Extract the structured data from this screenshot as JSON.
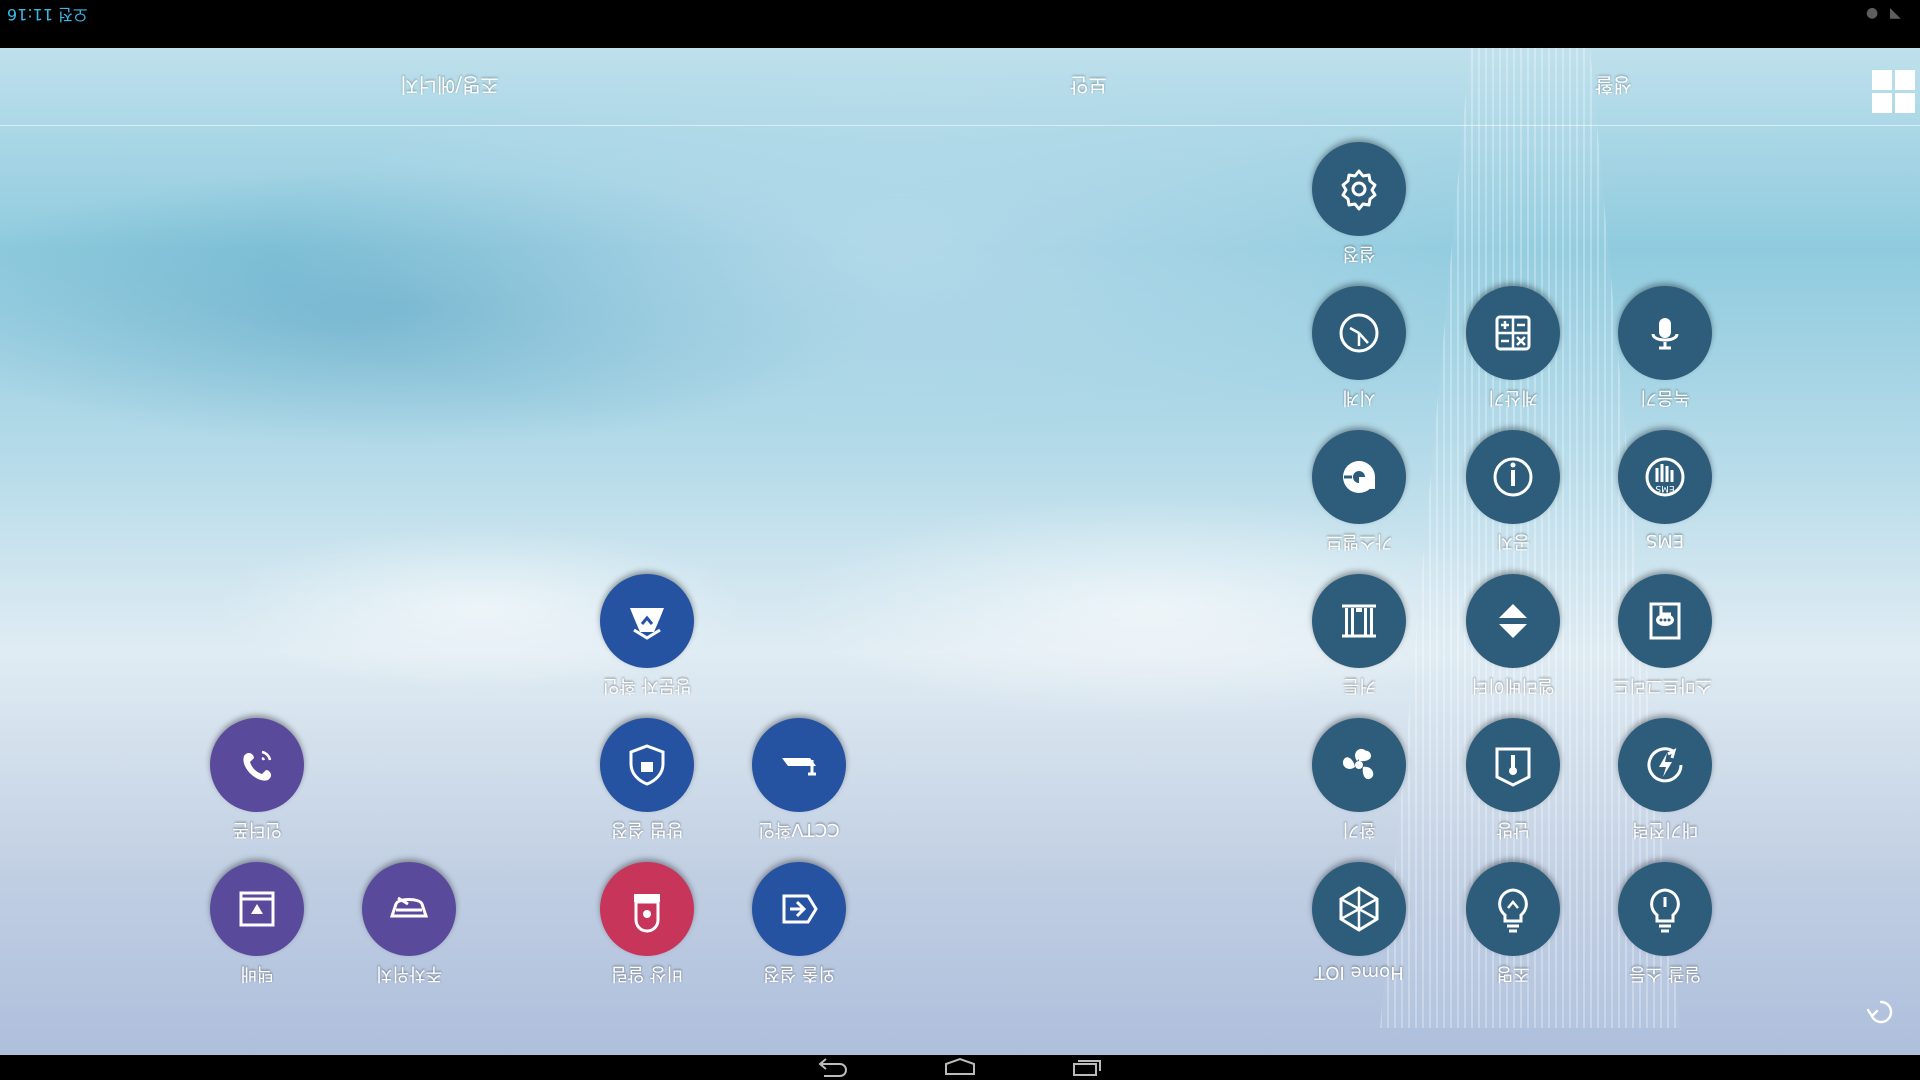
{
  "status_bar": {
    "time": "오전 11:16"
  },
  "dock": {
    "tabs": [
      "조명/에너지",
      "보안",
      "생활"
    ],
    "apps_icon": "app-grid-icon"
  },
  "apps": [
    {
      "id": "light-all-off",
      "label": "일괄 소등",
      "icon": "power-bulb-icon",
      "color": "#2d5d7b"
    },
    {
      "id": "light",
      "label": "조명",
      "icon": "bulb-icon",
      "color": "#2d5d7b"
    },
    {
      "id": "home-iot",
      "label": "Home IOT",
      "icon": "hex-network-icon",
      "color": "#2d5d7b"
    },
    {
      "id": "standby-power",
      "label": "대기전력",
      "icon": "lightning-cycle-icon",
      "color": "#2d5d7b"
    },
    {
      "id": "heating",
      "label": "난방",
      "icon": "thermometer-icon",
      "color": "#2d5d7b"
    },
    {
      "id": "fan",
      "label": "환기",
      "icon": "fan-icon",
      "color": "#2d5d7b"
    },
    {
      "id": "smart-grid",
      "label": "스마트그리드",
      "icon": "chat-doc-icon",
      "color": "#2d5d7b"
    },
    {
      "id": "elevator",
      "label": "엘리베이터",
      "icon": "elevator-icon",
      "color": "#2d5d7b"
    },
    {
      "id": "curtain",
      "label": "커튼",
      "icon": "curtain-icon",
      "color": "#2d5d7b"
    },
    {
      "id": "ems",
      "label": "EMS",
      "icon": "ems-icon",
      "color": "#2d5d7b"
    },
    {
      "id": "notice",
      "label": "공지",
      "icon": "exclamation-icon",
      "color": "#2d5d7b"
    },
    {
      "id": "gas",
      "label": "가스밸브",
      "icon": "gas-valve-icon",
      "color": "#2d5d7b"
    },
    {
      "id": "recorder",
      "label": "녹음기",
      "icon": "microphone-icon",
      "color": "#2d5d7b"
    },
    {
      "id": "calculator",
      "label": "계산기",
      "icon": "calculator-icon",
      "color": "#2d5d7b"
    },
    {
      "id": "clock",
      "label": "시계",
      "icon": "clock-icon",
      "color": "#2d5d7b"
    },
    {
      "id": "settings",
      "label": "설정",
      "icon": "gear-icon",
      "color": "#2d5d7b"
    },
    {
      "id": "outing",
      "label": "외출 설정",
      "icon": "exit-door-icon",
      "color": "#2553a1"
    },
    {
      "id": "emergency",
      "label": "비상 알림",
      "icon": "siren-icon",
      "color": "#c8355a"
    },
    {
      "id": "cctv",
      "label": "CCTV확인",
      "icon": "cctv-icon",
      "color": "#2553a1"
    },
    {
      "id": "security-set",
      "label": "방범 설정",
      "icon": "shield-icon",
      "color": "#2553a1"
    },
    {
      "id": "visitor",
      "label": "방문자 확인",
      "icon": "visitor-icon",
      "color": "#2553a1"
    },
    {
      "id": "delivery",
      "label": "택배",
      "icon": "parcel-box-icon",
      "color": "#5a4a9c"
    },
    {
      "id": "parking",
      "label": "주차위치",
      "icon": "car-icon",
      "color": "#5a4a9c"
    },
    {
      "id": "intercom",
      "label": "인터폰",
      "icon": "phone-icon",
      "color": "#5a4a9c"
    }
  ]
}
